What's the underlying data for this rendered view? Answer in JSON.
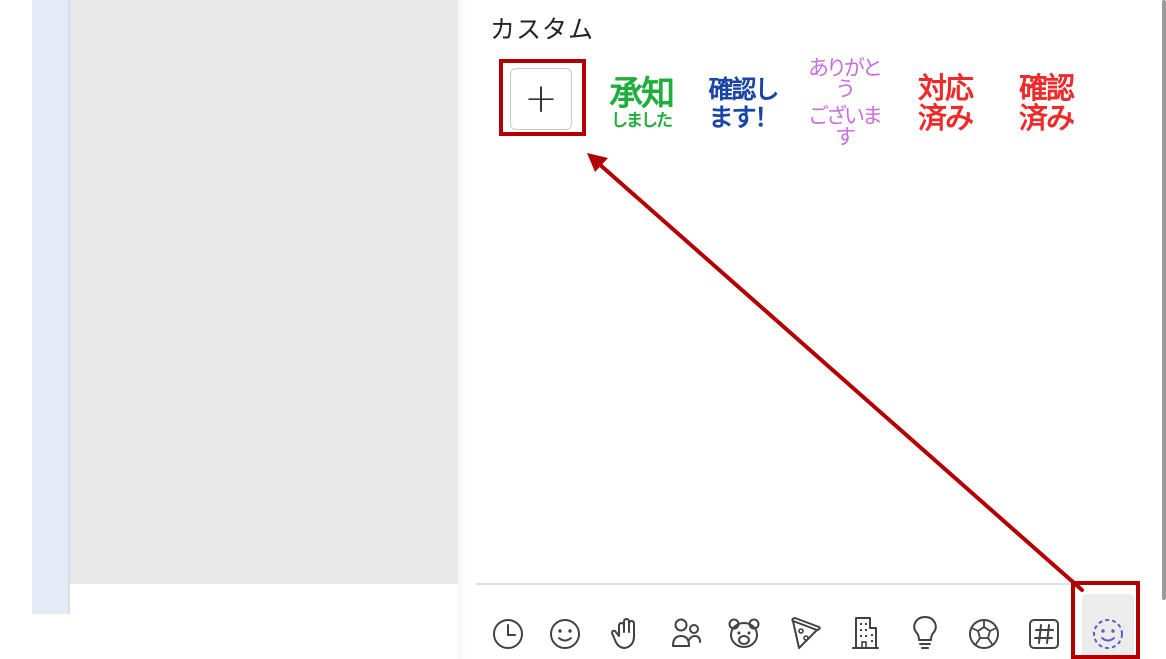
{
  "section": {
    "title": "カスタム"
  },
  "add_button": {
    "label": "+"
  },
  "stickers": [
    {
      "line1": "承知",
      "line2": "しました",
      "color": "#1fae3c"
    },
    {
      "line1": "確認し",
      "line2": "ます！",
      "color": "#1a45a8"
    },
    {
      "line1": "ありがとう",
      "line2": "ございます",
      "color": "#c96fdc"
    },
    {
      "line1": "対応",
      "line2": "済み",
      "color": "#ee2b2b"
    },
    {
      "line1": "確認",
      "line2": "済み",
      "color": "#ee2b2b"
    }
  ],
  "tabs": [
    {
      "icon": "clock-icon"
    },
    {
      "icon": "smiley-icon"
    },
    {
      "icon": "hand-icon"
    },
    {
      "icon": "people-icon"
    },
    {
      "icon": "bear-icon"
    },
    {
      "icon": "pizza-icon"
    },
    {
      "icon": "building-icon"
    },
    {
      "icon": "lightbulb-icon"
    },
    {
      "icon": "soccer-ball-icon"
    },
    {
      "icon": "hashtag-icon"
    },
    {
      "icon": "custom-emoji-icon",
      "selected": true
    }
  ],
  "colors": {
    "highlight": "#b20000",
    "accent": "#5b5fc7",
    "icon": "#424242"
  }
}
